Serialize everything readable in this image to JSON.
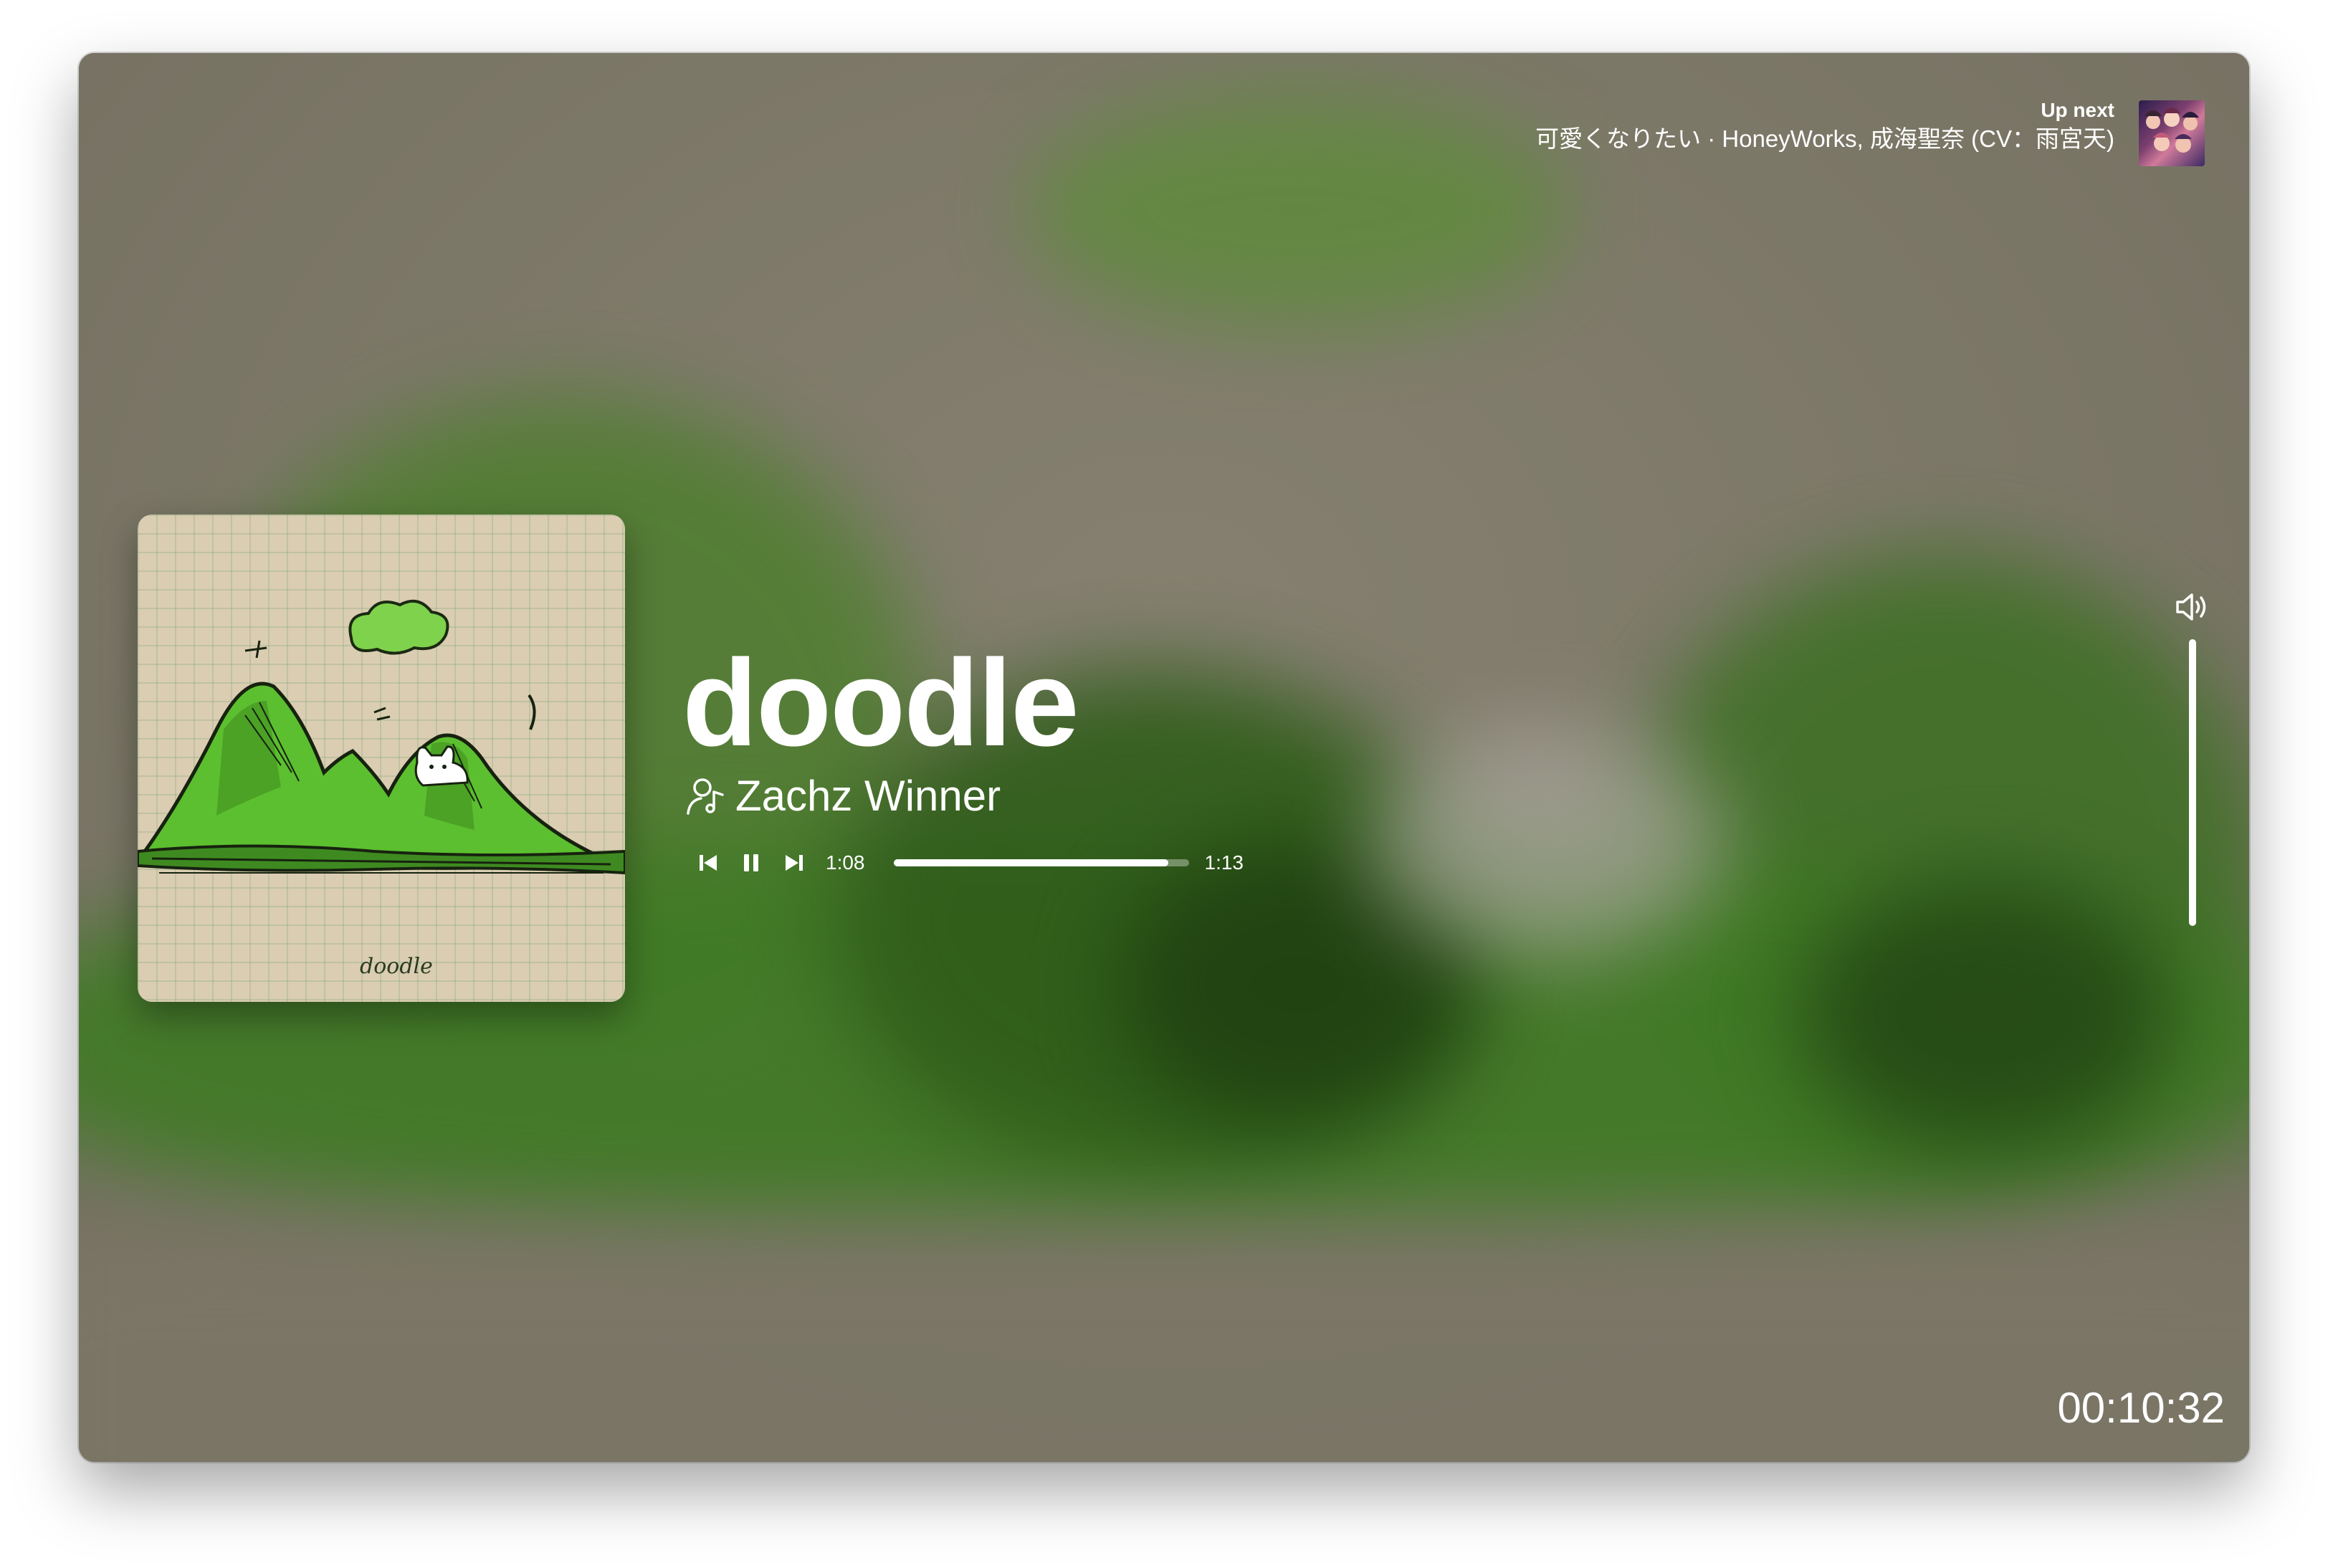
{
  "up_next": {
    "label": "Up next",
    "track": "可愛くなりたい · HoneyWorks, 成海聖奈 (CV：雨宮天)"
  },
  "now_playing": {
    "title": "doodle",
    "artist": "Zachz Winner",
    "album_art_caption": "doodle"
  },
  "playback": {
    "elapsed": "1:08",
    "duration": "1:13",
    "progress_fraction": 0.932,
    "state": "playing"
  },
  "volume": {
    "level_fraction": 1.0
  },
  "clock": "00:10:32",
  "icons": {
    "previous": "skip-previous-icon",
    "pause": "pause-icon",
    "next": "skip-next-icon",
    "artist": "artist-icon",
    "volume": "volume-icon"
  }
}
